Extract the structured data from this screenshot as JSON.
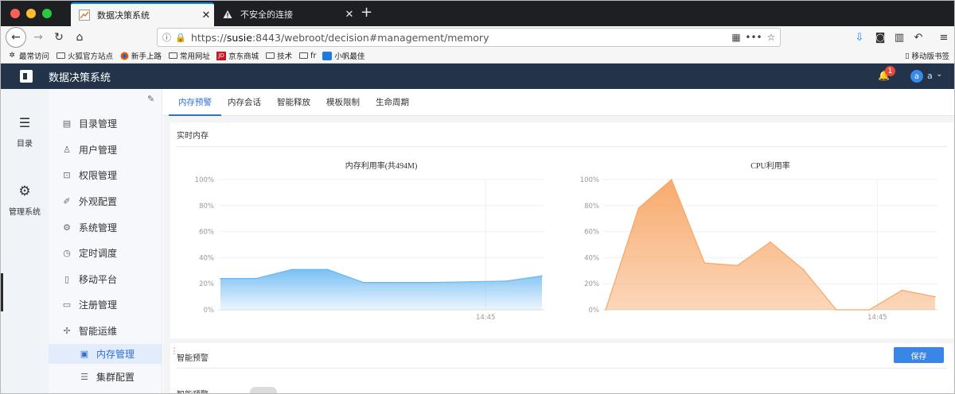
{
  "browser": {
    "tabs": [
      {
        "title": "数据决策系统",
        "active": true
      },
      {
        "title": "不安全的连接",
        "active": false
      }
    ],
    "url_prefix": "https://",
    "url_host": "susie",
    "url_rest": ":8443/webroot/decision#management/memory",
    "bookmarks": [
      {
        "label": "最常访问",
        "icon": "gear-icon"
      },
      {
        "label": "火狐官方站点",
        "icon": "folder-icon"
      },
      {
        "label": "新手上路",
        "icon": "firefox-icon"
      },
      {
        "label": "常用网址",
        "icon": "folder-icon"
      },
      {
        "label": "京东商城",
        "icon": "jd-icon"
      },
      {
        "label": "技术",
        "icon": "folder-icon"
      },
      {
        "label": "fr",
        "icon": "folder-icon"
      },
      {
        "label": "小帆最佳",
        "icon": "fanruan-icon"
      }
    ],
    "mobile_bookmarks": "移动版书签",
    "jd_icon_text": "JD"
  },
  "app": {
    "title": "数据决策系统",
    "notification_count": "1",
    "user_initial": "a",
    "user_name": "a"
  },
  "leftbar": [
    {
      "label": "目录",
      "icon": "list-icon"
    },
    {
      "label": "管理系统",
      "icon": "gear-icon",
      "active": true
    }
  ],
  "menu": [
    {
      "label": "目录管理",
      "icon": "catalog-icon"
    },
    {
      "label": "用户管理",
      "icon": "user-icon"
    },
    {
      "label": "权限管理",
      "icon": "lock-icon"
    },
    {
      "label": "外观配置",
      "icon": "brush-icon"
    },
    {
      "label": "系统管理",
      "icon": "settings-icon"
    },
    {
      "label": "定时调度",
      "icon": "timer-icon"
    },
    {
      "label": "移动平台",
      "icon": "mobile-icon"
    },
    {
      "label": "注册管理",
      "icon": "register-icon"
    },
    {
      "label": "智能运维",
      "icon": "ops-icon"
    },
    {
      "label": "内存管理",
      "icon": "memory-icon",
      "selected": true
    },
    {
      "label": "集群配置",
      "icon": "cluster-icon"
    }
  ],
  "content_tabs": [
    {
      "label": "内存预警",
      "active": true
    },
    {
      "label": "内存会话"
    },
    {
      "label": "智能释放"
    },
    {
      "label": "模板限制"
    },
    {
      "label": "生命周期"
    }
  ],
  "realtime": {
    "section_title": "实时内存"
  },
  "chart_data": [
    {
      "type": "area",
      "title": "内存利用率(共494M)",
      "ylim": [
        0,
        100
      ],
      "yticks": [
        "0%",
        "20%",
        "40%",
        "60%",
        "80%",
        "100%"
      ],
      "xtick_label": "14:45",
      "color": "#69b8f2",
      "values": [
        24,
        24,
        31,
        31,
        21,
        21,
        21,
        21.5,
        22,
        26
      ]
    },
    {
      "type": "area",
      "title": "CPU利用率",
      "ylim": [
        0,
        100
      ],
      "yticks": [
        "0%",
        "20%",
        "40%",
        "60%",
        "80%",
        "100%"
      ],
      "xtick_label": "14:45",
      "color": "#f7a666",
      "values": [
        0,
        78,
        100,
        36,
        34,
        52,
        31,
        0,
        0,
        15,
        10
      ]
    }
  ],
  "warning": {
    "section_title": "智能预警",
    "save_label": "保存",
    "switch_label": "智能预警"
  }
}
